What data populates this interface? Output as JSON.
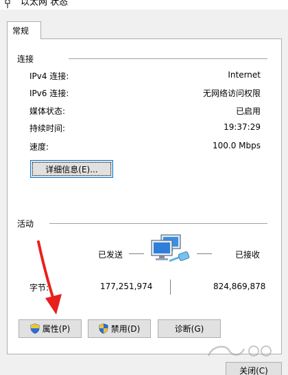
{
  "window": {
    "title": "以太网 状态"
  },
  "tabs": [
    {
      "label": "常规"
    }
  ],
  "connection": {
    "section_label": "连接",
    "rows": [
      {
        "label": "IPv4 连接:",
        "value": "Internet"
      },
      {
        "label": "IPv6 连接:",
        "value": "无网络访问权限"
      },
      {
        "label": "媒体状态:",
        "value": "已启用"
      },
      {
        "label": "持续时间:",
        "value": "19:37:29"
      },
      {
        "label": "速度:",
        "value": "100.0 Mbps"
      }
    ],
    "details_button": "详细信息(E)..."
  },
  "activity": {
    "section_label": "活动",
    "sent_label": "已发送",
    "received_label": "已接收",
    "bytes_label": "字节:",
    "bytes_sent": "177,251,974",
    "bytes_received": "824,869,878",
    "network_icon": "network-computers-icon"
  },
  "buttons": {
    "properties": "属性(P)",
    "disable": "禁用(D)",
    "diagnose": "诊断(G)",
    "close": "关闭(C)"
  },
  "colors": {
    "accent": "#0078d7",
    "annotation_arrow": "#e8201b"
  }
}
